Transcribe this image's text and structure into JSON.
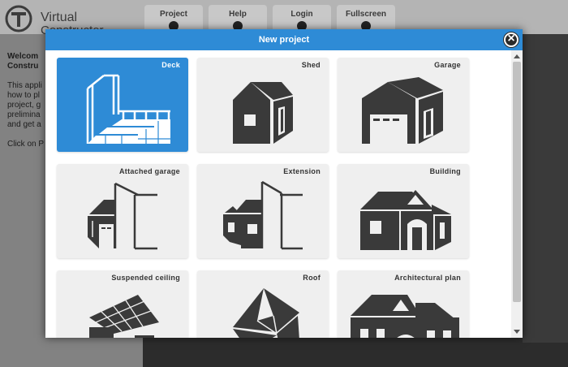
{
  "app": {
    "logo_line1": "Virtual",
    "logo_line2": "Constructor",
    "menu": [
      {
        "label": "Project",
        "icon": "grid-icon"
      },
      {
        "label": "Help",
        "icon": "question-icon"
      },
      {
        "label": "Login",
        "icon": "user-icon"
      },
      {
        "label": "Fullscreen",
        "icon": "fullscreen-icon"
      }
    ],
    "left_text": {
      "line1": "Welcom",
      "line2": "Constru",
      "line3": "This appli",
      "line4": "how to pl",
      "line5": "project, g",
      "line6": "prelimina",
      "line7": "and get a",
      "line8": "Click on P"
    }
  },
  "modal": {
    "title": "New project",
    "tiles": [
      {
        "label": "Deck",
        "selected": true
      },
      {
        "label": "Shed",
        "selected": false
      },
      {
        "label": "Garage",
        "selected": false
      },
      {
        "label": "Attached garage",
        "selected": false
      },
      {
        "label": "Extension",
        "selected": false
      },
      {
        "label": "Building",
        "selected": false
      },
      {
        "label": "Suspended ceiling",
        "selected": false
      },
      {
        "label": "Roof",
        "selected": false
      },
      {
        "label": "Architectural plan",
        "selected": false
      }
    ]
  },
  "colors": {
    "accent": "#2e8bd6",
    "tile_bg": "#efefef",
    "icon_dark": "#3a3a3a"
  }
}
